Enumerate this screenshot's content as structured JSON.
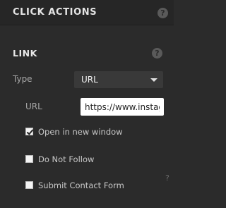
{
  "header": {
    "title": "CLICK ACTIONS",
    "help_glyph": "?"
  },
  "link": {
    "title": "LINK",
    "help_glyph": "?",
    "type_label": "Type",
    "type_value": "URL",
    "url_label": "URL",
    "url_value": "https://www.instagr",
    "options": [
      {
        "label": "Open in new window",
        "checked": true
      },
      {
        "label": "Do Not Follow",
        "checked": false
      },
      {
        "label": "Submit Contact Form",
        "checked": false
      }
    ],
    "do_not_follow_help": "?"
  }
}
